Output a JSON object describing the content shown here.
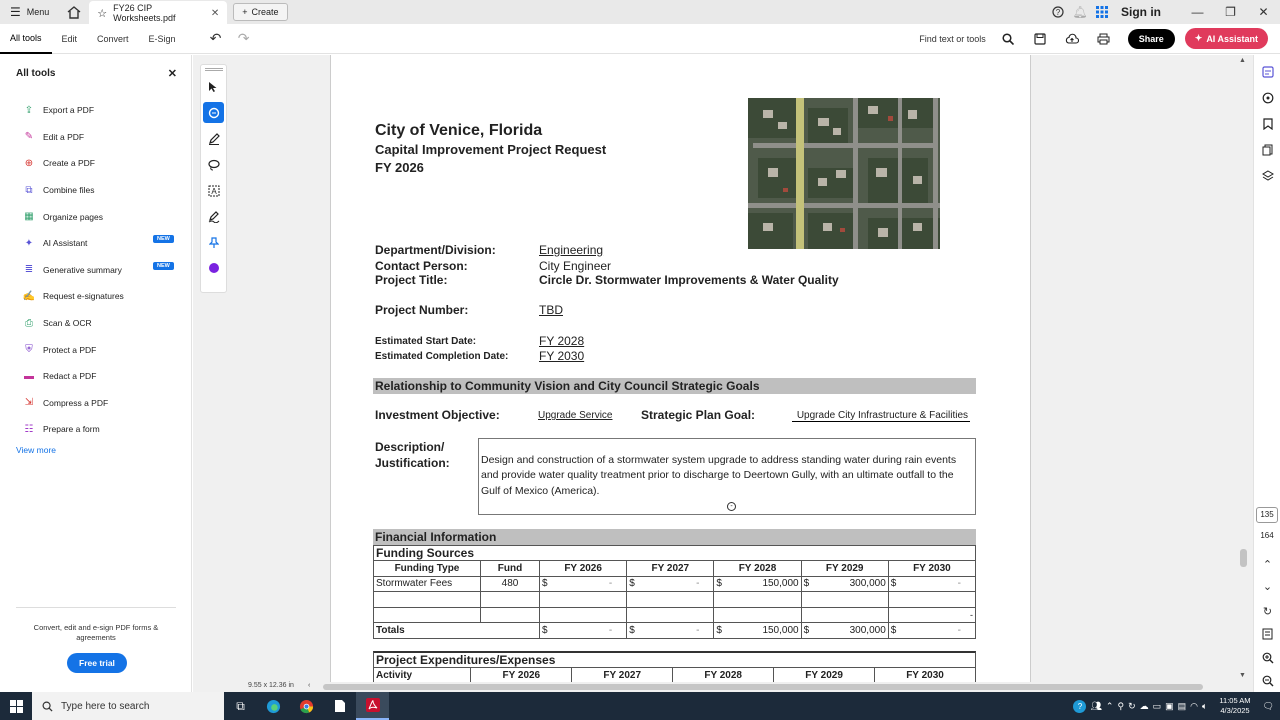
{
  "titlebar": {
    "menu_label": "Menu",
    "tab_title": "FY26 CIP Worksheets.pdf",
    "create_label": "Create",
    "signin_label": "Sign in"
  },
  "toolbar": {
    "tabs": [
      "All tools",
      "Edit",
      "Convert",
      "E-Sign"
    ],
    "find_label": "Find text or tools",
    "share_label": "Share",
    "ai_label": "AI Assistant"
  },
  "leftpanel": {
    "title": "All tools",
    "items": [
      {
        "label": "Export a PDF",
        "icon": "export-pdf-icon",
        "color": "#2e9e6a"
      },
      {
        "label": "Edit a PDF",
        "icon": "edit-pdf-icon",
        "color": "#c4349a"
      },
      {
        "label": "Create a PDF",
        "icon": "create-pdf-icon",
        "color": "#d6342f"
      },
      {
        "label": "Combine files",
        "icon": "combine-files-icon",
        "color": "#5a55d6"
      },
      {
        "label": "Organize pages",
        "icon": "organize-pages-icon",
        "color": "#2e9e6a"
      },
      {
        "label": "AI Assistant",
        "icon": "ai-assistant-icon",
        "color": "#5a55d6",
        "badge": "NEW"
      },
      {
        "label": "Generative summary",
        "icon": "generative-summary-icon",
        "color": "#5a55d6",
        "badge": "NEW"
      },
      {
        "label": "Request e-signatures",
        "icon": "request-esignatures-icon",
        "color": "#a23cc8"
      },
      {
        "label": "Scan & OCR",
        "icon": "scan-ocr-icon",
        "color": "#2e9e6a"
      },
      {
        "label": "Protect a PDF",
        "icon": "protect-pdf-icon",
        "color": "#7a3cc8"
      },
      {
        "label": "Redact a PDF",
        "icon": "redact-pdf-icon",
        "color": "#c4349a"
      },
      {
        "label": "Compress a PDF",
        "icon": "compress-pdf-icon",
        "color": "#d6342f"
      },
      {
        "label": "Prepare a form",
        "icon": "prepare-form-icon",
        "color": "#a23cc8"
      }
    ],
    "view_more": "View more",
    "promo": "Convert, edit and e-sign PDF forms & agreements",
    "trial_label": "Free trial"
  },
  "document": {
    "city": "City of Venice, Florida",
    "subtitle1": "Capital Improvement Project Request",
    "subtitle2": "FY 2026",
    "fields": {
      "dept_label": "Department/Division:",
      "dept_value": "Engineering",
      "contact_label": "Contact Person:",
      "contact_value": "City Engineer",
      "title_label": "Project Title:",
      "title_value": "Circle Dr. Stormwater Improvements & Water Quality",
      "number_label": "Project Number:",
      "number_value": "TBD",
      "start_label": "Estimated Start Date:",
      "start_value": "FY 2028",
      "completion_label": "Estimated Completion Date:",
      "completion_value": "FY 2030"
    },
    "relationship_title": "Relationship  to Community Vision and City Council Strategic Goals",
    "investment_label": "Investment Objective:",
    "investment_value": "Upgrade Service",
    "strategic_label": "Strategic Plan Goal:",
    "strategic_value": "Upgrade City Infrastructure & Facilities",
    "desc_label_1": "Description/",
    "desc_label_2": "Justification:",
    "desc_text": "Design and construction of a stormwater system upgrade to address standing water during rain events and provide water quality treatment prior to discharge to Deertown Gully, with an ultimate outfall to the Gulf of Mexico (America).",
    "financial_title": "Financial Information",
    "funding_title": "Funding Sources",
    "funding_headers": [
      "Funding Type",
      "Fund",
      "FY 2026",
      "FY 2027",
      "FY 2028",
      "FY 2029",
      "FY 2030"
    ],
    "funding_row": {
      "type": "Stormwater Fees",
      "fund": "480",
      "values": [
        "-",
        "-",
        "150,000",
        "300,000",
        "-"
      ]
    },
    "extra_dash": "-",
    "totals_label": "Totals",
    "totals_values": [
      "-",
      "-",
      "150,000",
      "300,000",
      "-"
    ],
    "currency": "$",
    "expenditures_title": "Project Expenditures/Expenses",
    "expenditure_headers": [
      "Activity",
      "FY 2026",
      "FY 2027",
      "FY 2028",
      "FY 2029",
      "FY 2030"
    ]
  },
  "rightrail": {
    "page_current": "135",
    "page_total": "164"
  },
  "statusbar": {
    "page_size": "9.55 x 12.36 in"
  },
  "taskbar": {
    "search_placeholder": "Type here to search",
    "time": "11:05 AM",
    "date": "4/3/2025"
  }
}
